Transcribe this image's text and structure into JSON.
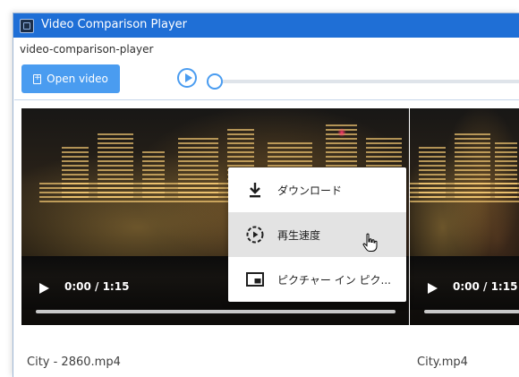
{
  "window": {
    "title": "Video Comparison Player",
    "icon": "app-window-icon"
  },
  "page_label": "video-comparison-player",
  "toolbar": {
    "open_button_label": "Open video",
    "open_button_icon": "file-add-icon",
    "play_icon": "play-circle-icon",
    "seek_progress": 0
  },
  "videos": [
    {
      "filename": "City - 2860.mp4",
      "time": "0:00 / 1:15",
      "progress": 0
    },
    {
      "filename": "City.mp4",
      "time": "0:00 / 1:15",
      "progress": 0
    }
  ],
  "context_menu": {
    "items": [
      {
        "label": "ダウンロード",
        "icon": "download-icon"
      },
      {
        "label": "再生速度",
        "icon": "playback-speed-icon"
      },
      {
        "label": "ピクチャー イン ピク...",
        "icon": "picture-in-picture-icon"
      }
    ],
    "hovered_index": 1
  },
  "colors": {
    "titlebar": "#1f6fd6",
    "accent": "#4a9cf0",
    "menu_hover": "#e3e3e3"
  }
}
